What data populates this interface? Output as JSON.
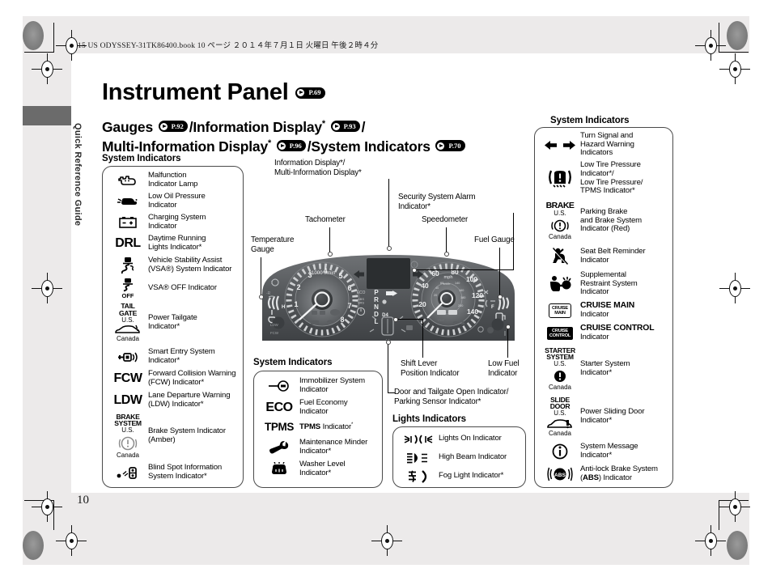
{
  "document": {
    "file_header": "15 US ODYSSEY-31TK86400.book   10 ページ   ２０１４年７月１日   火曜日   午後２時４分",
    "page_number": "10",
    "sidebar_label": "Quick Reference Guide"
  },
  "header": {
    "title": "Instrument Panel",
    "title_ref": "P.69",
    "subtitle_line1_a": "Gauges ",
    "subtitle_ref_gauges": "P.92",
    "subtitle_line1_b": "/Information Display",
    "subtitle_ref_info": "P.93",
    "subtitle_line1_c": "/",
    "subtitle_line2_a": "Multi-Information Display",
    "subtitle_ref_multi": "P.96",
    "subtitle_line2_b": "/System Indicators ",
    "subtitle_ref_sys": "P.70"
  },
  "captions": {
    "left_box": "System Indicators",
    "middle_box": "System Indicators",
    "lights_box": "Lights Indicators",
    "right_box": "System Indicators"
  },
  "left_indicators": [
    {
      "icon": "malfunction-indicator-lamp-icon",
      "text_line1": "Malfunction",
      "text_line2": "Indicator Lamp"
    },
    {
      "icon": "low-oil-pressure-icon",
      "text_line1": "Low Oil Pressure",
      "text_line2": "Indicator"
    },
    {
      "icon": "charging-system-icon",
      "text_line1": "Charging System",
      "text_line2": "Indicator"
    },
    {
      "icon": "drl-text-icon",
      "icon_text": "DRL",
      "text_line1": "Daytime Running",
      "text_line2": "Lights Indicator*"
    },
    {
      "icon": "vsa-system-icon",
      "text_line1": "Vehicle Stability Assist",
      "text_line2": "(VSA®) System Indicator"
    },
    {
      "icon": "vsa-off-icon",
      "icon_sub": "OFF",
      "text_line1": "VSA® OFF Indicator",
      "text_line2": ""
    },
    {
      "icon": "power-tailgate-icon",
      "icon_text": "TAIL\nGATE",
      "region_us": "U.S.",
      "region_ca": "Canada",
      "text_line1": "Power Tailgate",
      "text_line2": "Indicator*"
    },
    {
      "icon": "smart-entry-icon",
      "text_line1": "Smart Entry System",
      "text_line2": "Indicator*"
    },
    {
      "icon": "fcw-text-icon",
      "icon_text": "FCW",
      "text_line1": "Forward Collision Warning",
      "text_line2": "(FCW) Indicator*"
    },
    {
      "icon": "ldw-text-icon",
      "icon_text": "LDW",
      "text_line1": "Lane Departure Warning",
      "text_line2": "(LDW) Indicator*"
    },
    {
      "icon": "brake-system-amber-icon",
      "icon_text": "BRAKE\nSYSTEM",
      "region_us": "U.S.",
      "region_ca": "Canada",
      "text_line1": "Brake System Indicator",
      "text_line2": "(Amber)"
    },
    {
      "icon": "blind-spot-information-icon",
      "text_line1": "Blind Spot Information",
      "text_line2": "System Indicator*"
    }
  ],
  "middle_indicators": [
    {
      "icon": "immobilizer-key-icon",
      "text_line1": "Immobilizer System",
      "text_line2": "Indicator"
    },
    {
      "icon": "eco-text-icon",
      "icon_text": "ECO",
      "text_line1": "Fuel Economy",
      "text_line2": "Indicator"
    },
    {
      "icon": "tpms-text-icon",
      "icon_text": "TPMS",
      "text_line1": "TPMS Indicator*",
      "text_line2": "",
      "bold_prefix": "TPMS"
    },
    {
      "icon": "maintenance-minder-wrench-icon",
      "text_line1": "Maintenance Minder",
      "text_line2": "Indicator*"
    },
    {
      "icon": "washer-level-icon",
      "text_line1": "Washer Level",
      "text_line2": "Indicator*"
    }
  ],
  "lights_indicators": [
    {
      "icon": "lights-on-icon",
      "text_line1": "Lights On Indicator"
    },
    {
      "icon": "high-beam-icon",
      "text_line1": "High Beam Indicator"
    },
    {
      "icon": "fog-light-icon",
      "text_line1": "Fog Light Indicator*"
    }
  ],
  "right_indicators": [
    {
      "icon": "turn-signal-arrows-icon",
      "text_line1": "Turn Signal and",
      "text_line2": "Hazard Warning",
      "text_line3": "Indicators"
    },
    {
      "icon": "low-tire-pressure-icon",
      "text_line1": "Low Tire Pressure",
      "text_line2": "Indicator*/",
      "text_line3": "Low Tire Pressure/",
      "text_line4": "TPMS Indicator*"
    },
    {
      "icon": "parking-brake-icon",
      "icon_text": "BRAKE",
      "region_us": "U.S.",
      "region_ca": "Canada",
      "text_line1": "Parking Brake",
      "text_line2": "and Brake System",
      "text_line3": "Indicator (Red)"
    },
    {
      "icon": "seat-belt-reminder-icon",
      "text_line1": "Seat Belt Reminder",
      "text_line2": "Indicator"
    },
    {
      "icon": "supplemental-restraint-icon",
      "text_line1": "Supplemental",
      "text_line2": "Restraint System",
      "text_line3": "Indicator"
    },
    {
      "icon": "cruise-main-icon",
      "icon_text": "CRUISE MAIN",
      "text_line1": "CRUISE MAIN",
      "text_line2": "Indicator",
      "bold_line1": true
    },
    {
      "icon": "cruise-control-icon",
      "icon_text": "CRUISE CONTROL",
      "text_line1": "CRUISE CONTROL",
      "text_line2": "Indicator",
      "bold_line1": true
    },
    {
      "icon": "starter-system-icon",
      "icon_text": "STARTER\nSYSTEM",
      "region_us": "U.S.",
      "region_ca": "Canada",
      "text_line1": "Starter System",
      "text_line2": "Indicator*"
    },
    {
      "icon": "power-sliding-door-icon",
      "icon_text": "SLIDE\nDOOR",
      "region_us": "U.S.",
      "region_ca": "Canada",
      "text_line1": "Power Sliding Door",
      "text_line2": "Indicator*"
    },
    {
      "icon": "system-message-icon",
      "text_line1": "System Message",
      "text_line2": "Indicator*"
    },
    {
      "icon": "abs-icon",
      "text_line1": "Anti-lock Brake System",
      "text_line2": "(ABS) Indicator"
    }
  ],
  "callouts": {
    "info_display": "Information Display*/",
    "info_display_2": "Multi-Information Display*",
    "security_alarm": "Security System Alarm",
    "security_alarm_2": "Indicator*",
    "tachometer": "Tachometer",
    "speedometer": "Speedometer",
    "temperature_gauge": "Temperature",
    "temperature_gauge_2": "Gauge",
    "fuel_gauge": "Fuel Gauge",
    "shift_lever": "Shift Lever",
    "shift_lever_2": "Position Indicator",
    "low_fuel": "Low Fuel",
    "low_fuel_2": "Indicator",
    "door_tailgate": "Door and Tailgate Open Indicator/",
    "door_tailgate_2": "Parking Sensor Indicator*"
  },
  "cluster": {
    "tach_label": "x1000 r/min",
    "tach_ticks": [
      "1",
      "2",
      "3",
      "4",
      "5",
      "6",
      "7",
      "8"
    ],
    "speed_unit_mph": "mph",
    "speed_unit_kmh": "km/h",
    "speed_ticks_mph": [
      "20",
      "40",
      "60",
      "80",
      "100",
      "120",
      "140"
    ],
    "shift_positions": [
      "P",
      "R",
      "N",
      "D",
      "L"
    ],
    "shift_d4": "D4",
    "eco_label": "ECO",
    "abs_label": "ABS",
    "srs_label": "SRS"
  },
  "colors": {
    "page_bg": "#eceaea",
    "sheet_white": "#ffffff",
    "tab_gray": "#6b6b6b",
    "ink": "#000000",
    "cluster_dark": "#4a4b4d",
    "cluster_mid": "#6e7073",
    "cluster_light": "#c9cbcd"
  }
}
